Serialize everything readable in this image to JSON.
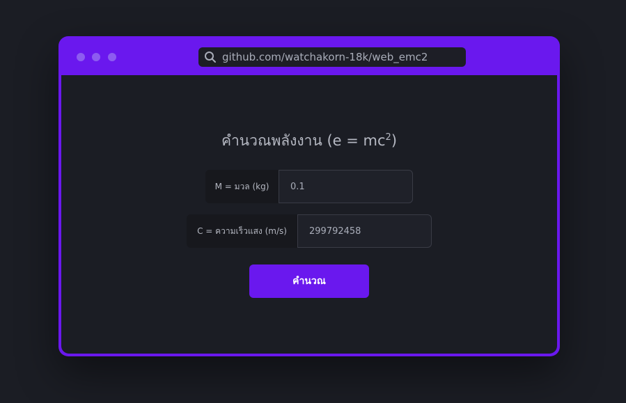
{
  "browser": {
    "url": "github.com/watchakorn-18k/web_emc2",
    "window_dots": [
      "dot",
      "dot",
      "dot"
    ]
  },
  "page": {
    "heading_text": "คำนวณพลังงาน (e = mc",
    "heading_superscript": "2",
    "heading_suffix": ")"
  },
  "form": {
    "mass_label": "M = มวล (kg)",
    "mass_value": "0.1",
    "speed_label": "C = ความเร็วแสง (m/s)",
    "speed_value": "299792458",
    "submit_label": "คำนวณ"
  },
  "colors": {
    "accent": "#6a18ee",
    "background": "#1b1d24",
    "text": "#b5b8c2"
  },
  "icons": {
    "search": "search-icon"
  }
}
